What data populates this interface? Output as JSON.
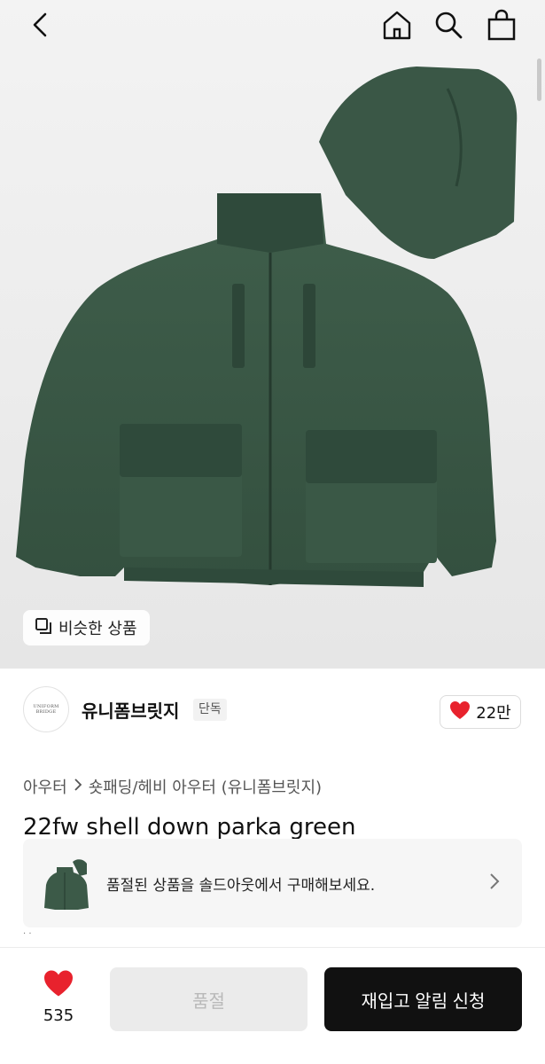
{
  "header": {
    "back_icon": "chevron-left-icon",
    "home_icon": "home-icon",
    "search_icon": "search-icon",
    "bag_icon": "shopping-bag-icon"
  },
  "hero": {
    "similar_label": "비슷한 상품"
  },
  "brand": {
    "logo_text": "UNIFORM BRIDGE",
    "name": "유니폼브릿지",
    "tag": "단독",
    "likes": "22만"
  },
  "breadcrumb": {
    "category": "아우터",
    "subcategory": "숏패딩/헤비 아우터 (유니폼브릿지)"
  },
  "product": {
    "title": "22fw shell down parka green"
  },
  "soldout_banner": {
    "text": "품절된 상품을 솔드아웃에서 구매해보세요."
  },
  "bottom": {
    "wish_count": "535",
    "soldout_label": "품절",
    "restock_label": "재입고 알림 신청"
  },
  "colors": {
    "jacket_green": "#3c5a48",
    "heart_red": "#e8222d",
    "cta_black": "#111111"
  }
}
